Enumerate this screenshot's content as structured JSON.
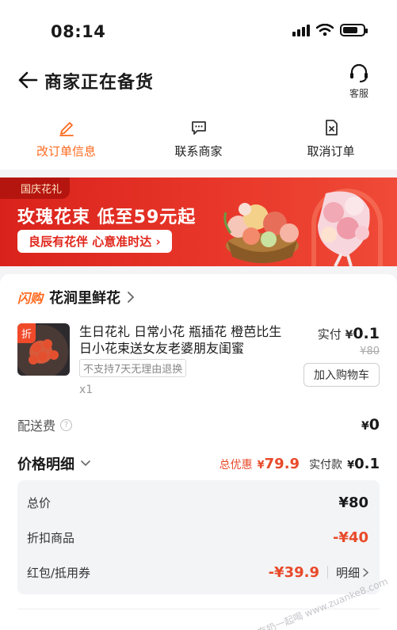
{
  "status": {
    "time": "08:14",
    "battery_level": 0.75
  },
  "nav": {
    "title": "商家正在备货",
    "service_label": "客服"
  },
  "actions": [
    {
      "label": "改订单信息",
      "icon": "edit-icon",
      "active": true
    },
    {
      "label": "联系商家",
      "icon": "chat-icon",
      "active": false
    },
    {
      "label": "取消订单",
      "icon": "cancel-doc-icon",
      "active": false
    }
  ],
  "banner": {
    "tag": "国庆花礼",
    "title": "玫瑰花束 低至59元起",
    "pill": "良辰有花伴 心意准时达 ›"
  },
  "shop": {
    "badge": "闪购",
    "name": "花涧里鲜花"
  },
  "product": {
    "discount_badge": "折",
    "title": "生日花礼 日常小花 瓶插花 橙芭比生日小花束送女友老婆朋友闺蜜",
    "no_return": "不支持7天无理由退换",
    "qty": "x1",
    "paid_label": "实付",
    "paid_currency": "¥",
    "paid_value": "0.1",
    "original_price": "¥80",
    "cart_button": "加入购物车"
  },
  "delivery": {
    "label": "配送费",
    "help": "?",
    "currency": "¥",
    "value": "0"
  },
  "price_detail": {
    "title": "价格明细",
    "saving_label": "总优惠",
    "saving_currency": "¥",
    "saving_value": "79.9",
    "actual_label": "实付款",
    "actual_currency": "¥",
    "actual_value": "0.1",
    "rows": [
      {
        "label": "总价",
        "value": "¥80"
      },
      {
        "label": "折扣商品",
        "value": "-¥40"
      },
      {
        "label": "红包/抵用券",
        "value": "-¥39.9",
        "link": "明细"
      }
    ]
  },
  "watermark": "赚客吧，有奶一起喝 www.zuanke8.com",
  "colors": {
    "accent": "#ff6a1f",
    "discount_red": "#e84a2a",
    "banner_red": "#e1261b"
  }
}
